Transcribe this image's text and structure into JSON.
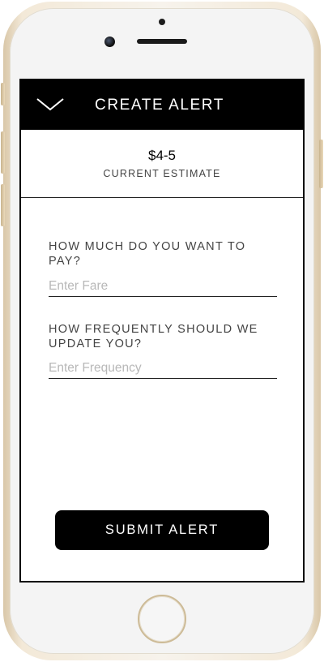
{
  "header": {
    "title": "CREATE ALERT",
    "back_icon": "chevron-down-icon"
  },
  "estimate": {
    "value": "$4-5",
    "label": "CURRENT ESTIMATE"
  },
  "form": {
    "fare_question": "HOW MUCH DO YOU WANT TO PAY?",
    "fare_placeholder": "Enter Fare",
    "fare_value": "",
    "frequency_question": "HOW FREQUENTLY SHOULD WE UPDATE YOU?",
    "frequency_placeholder": "Enter Frequency",
    "frequency_value": ""
  },
  "submit_label": "SUBMIT ALERT",
  "colors": {
    "header_bg": "#000000",
    "accent": "#000000",
    "placeholder": "#b8b8b8"
  }
}
